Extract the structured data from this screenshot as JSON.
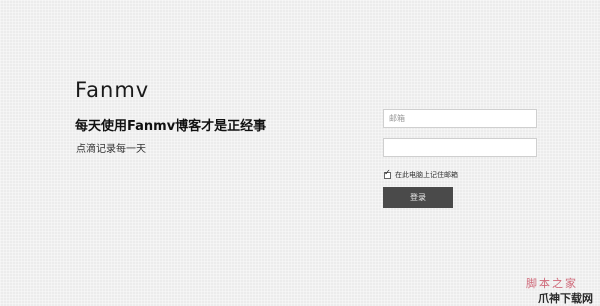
{
  "brand": {
    "logo_text": "Fanmv"
  },
  "hero": {
    "tagline": "每天使用Fanmv博客才是正经事",
    "subline": "点滴记录每一天"
  },
  "form": {
    "email_placeholder": "邮箱",
    "password_placeholder": "",
    "remember_label": "在此电脑上记住邮箱",
    "remember_checked": true,
    "submit_label": "登录"
  },
  "watermark": {
    "line1": "脚本之家",
    "line2": "爪神下载网"
  },
  "colors": {
    "background": "#ececec",
    "button": "#4a4a4a",
    "watermark_accent": "#d06a7a"
  }
}
